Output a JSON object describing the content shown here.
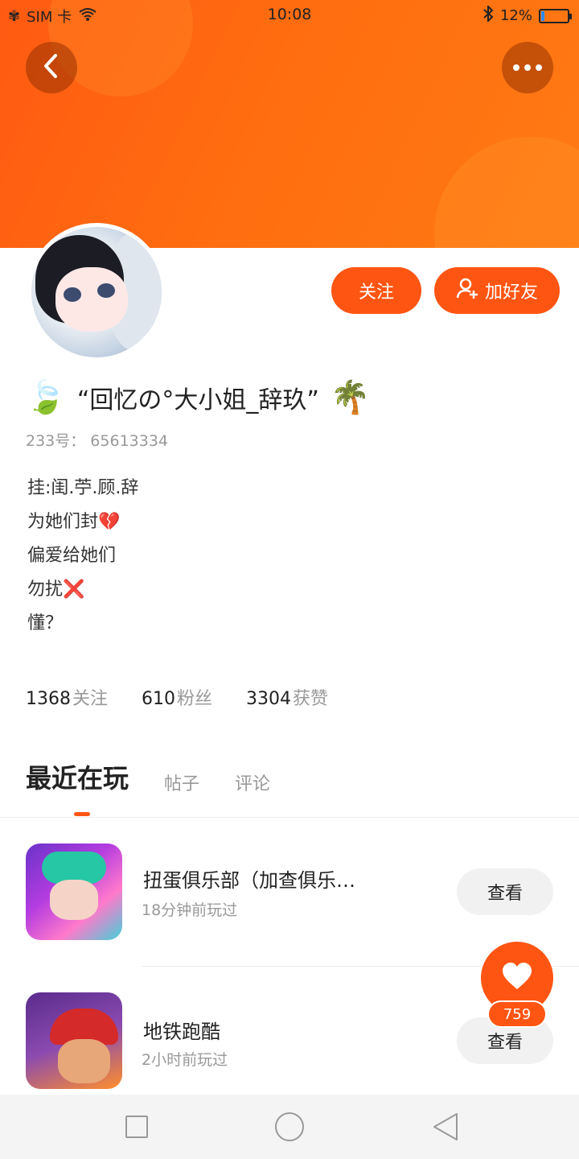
{
  "status_bar": {
    "carrier": "SIM 卡",
    "time": "10:08",
    "battery": "12%",
    "battery_level": 0.12
  },
  "header": {
    "back_icon": "chevron-left-icon",
    "more_icon": "more-dots-icon"
  },
  "actions": {
    "follow_label": "关注",
    "add_friend_label": "加好友"
  },
  "profile": {
    "emoji_left": "🍃",
    "name": "“回忆の°大小姐_辞玖”",
    "emoji_right": "🌴",
    "uid": "233号：  65613334",
    "bio": [
      "挂:闺.苧.顾.辞",
      "为她们封💔",
      "偏爱给她们",
      "勿扰❌",
      "懂？"
    ]
  },
  "stats": [
    {
      "value": "1368",
      "label": "关注"
    },
    {
      "value": "610",
      "label": "粉丝"
    },
    {
      "value": "3304",
      "label": "获赞"
    }
  ],
  "tabs": [
    "最近在玩",
    "帖子",
    "评论"
  ],
  "games": [
    {
      "title": "扭蛋俱乐部（加查俱乐…",
      "time": "18分钟前玩过",
      "button": "查看"
    },
    {
      "title": "地铁跑酷",
      "time": "2小时前玩过",
      "button": "查看"
    }
  ],
  "like": {
    "count": "759"
  },
  "colors": {
    "accent": "#ff5512",
    "header": "#ff6d10"
  }
}
